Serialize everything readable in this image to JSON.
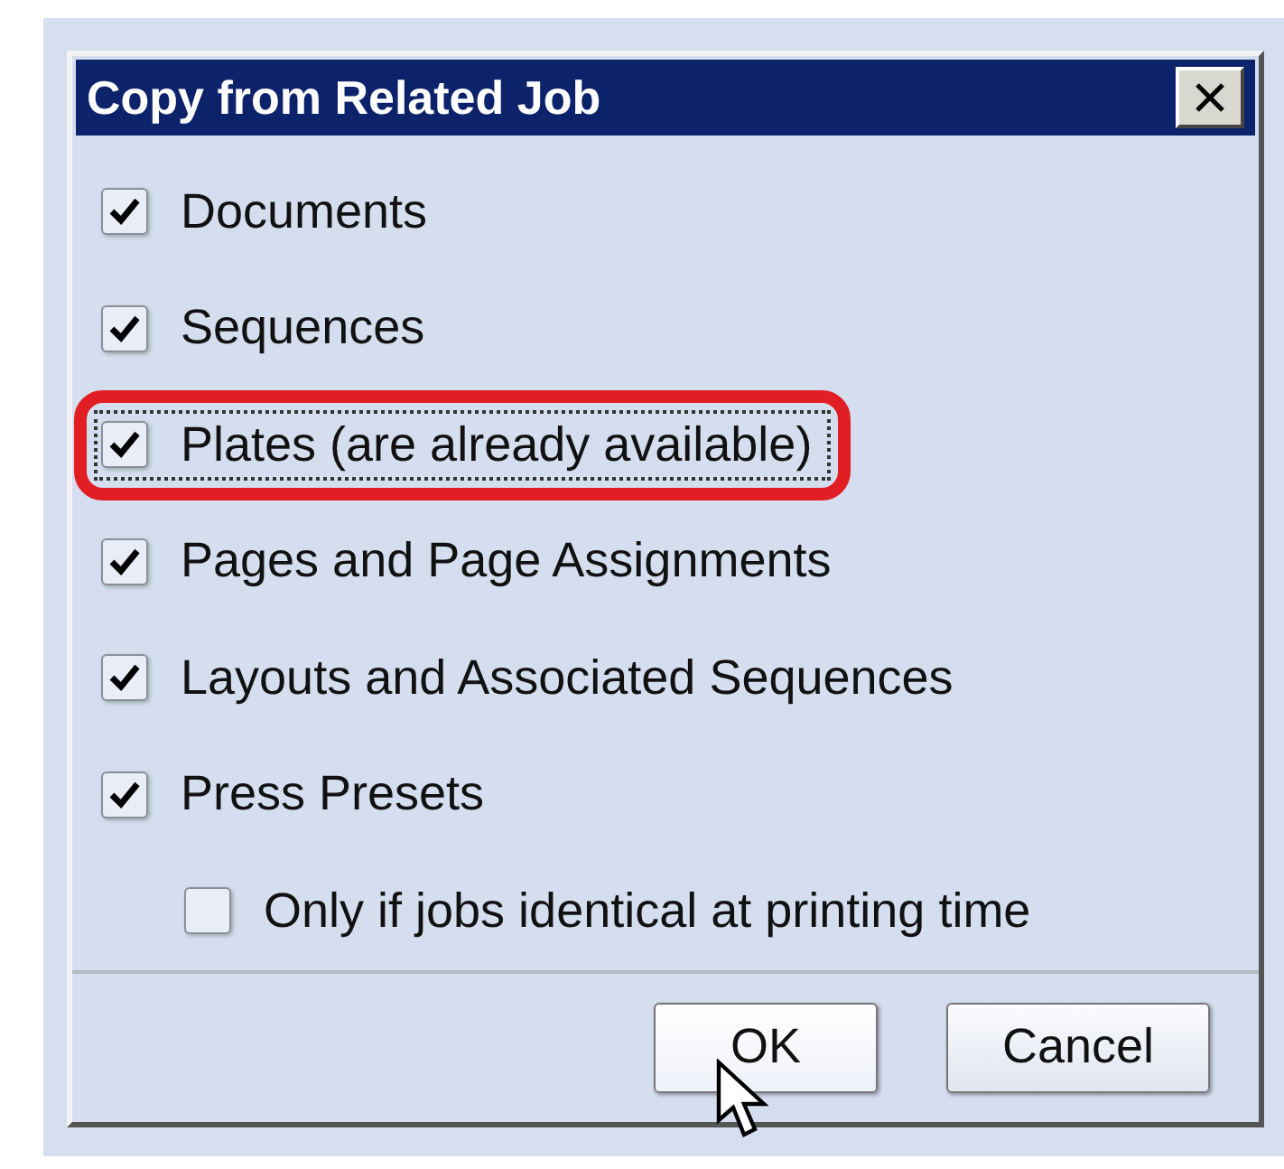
{
  "dialog": {
    "title": "Copy from Related Job",
    "options": [
      {
        "label": "Documents",
        "checked": true,
        "focused": false,
        "highlighted": false
      },
      {
        "label": "Sequences",
        "checked": true,
        "focused": false,
        "highlighted": false
      },
      {
        "label": "Plates (are already available)",
        "checked": true,
        "focused": true,
        "highlighted": true
      },
      {
        "label": "Pages and Page Assignments",
        "checked": true,
        "focused": false,
        "highlighted": false
      },
      {
        "label": "Layouts and Associated Sequences",
        "checked": true,
        "focused": false,
        "highlighted": false
      },
      {
        "label": "Press Presets",
        "checked": true,
        "focused": false,
        "highlighted": false,
        "children": [
          {
            "label": "Only if jobs identical at printing time",
            "checked": false,
            "focused": false,
            "highlighted": false
          }
        ]
      }
    ],
    "buttons": [
      {
        "label": "OK",
        "hovered": true
      },
      {
        "label": "Cancel",
        "hovered": false
      }
    ]
  }
}
